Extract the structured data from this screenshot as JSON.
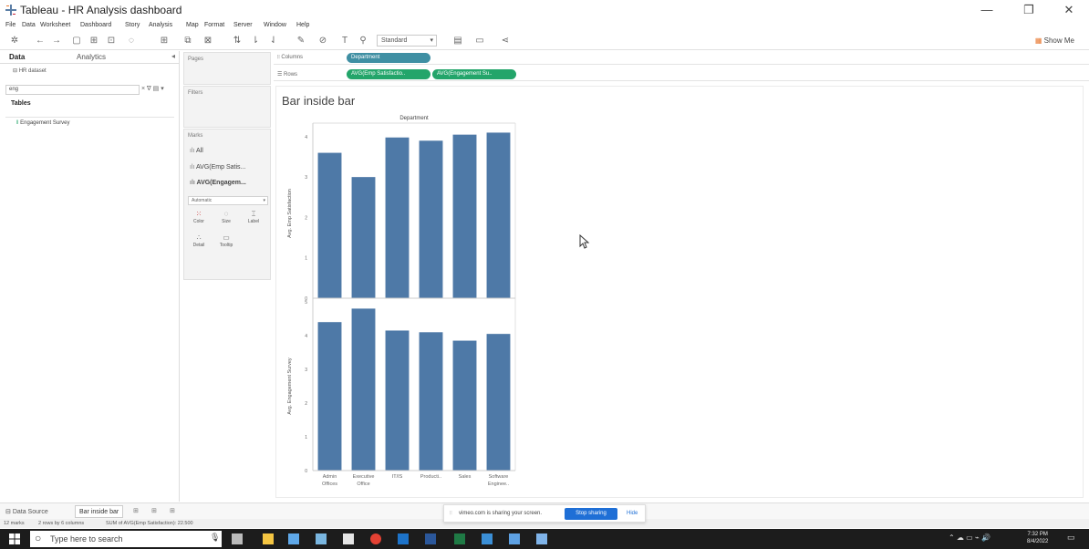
{
  "window": {
    "title": "Tableau - HR Analysis dashboard",
    "controls": [
      "—",
      "❐",
      "✕"
    ]
  },
  "menu": [
    "File",
    "Data",
    "Worksheet",
    "Dashboard",
    "Story",
    "Analysis",
    "Map",
    "Format",
    "Server",
    "Window",
    "Help"
  ],
  "toolbar": {
    "fit_select": "Standard",
    "show_me": "Show Me"
  },
  "data_pane": {
    "tab_data": "Data",
    "tab_analytics": "Analytics",
    "datasource": "HR dataset",
    "search_value": "eng",
    "tables_header": "Tables",
    "field": "Engagement Survey"
  },
  "cards": {
    "pages": "Pages",
    "filters": "Filters",
    "marks": "Marks",
    "marks_rows": [
      "All",
      "AVG(Emp Satis...",
      "AVG(Engagem..."
    ],
    "mark_type": "Automatic",
    "mark_buttons": [
      "Color",
      "Size",
      "Label",
      "Detail",
      "Tooltip"
    ]
  },
  "shelves": {
    "columns_label": "Columns",
    "rows_label": "Rows",
    "columns_pill": "Department",
    "rows_pills": [
      "AVG(Emp Satisfactio..",
      "AVG(Engagement Su.."
    ]
  },
  "colors": {
    "bar": "#4e79a7",
    "pill_dimension": "#3f8fa3",
    "pill_measure": "#23a56a",
    "stop_sharing": "#1f6fd6"
  },
  "viz": {
    "title": "Bar inside bar"
  },
  "chart_data": {
    "type": "bar",
    "title": "Bar inside bar",
    "column_header": "Department",
    "categories": [
      "Admin Offices",
      "Executive Office",
      "IT/IS",
      "Production",
      "Sales",
      "Software Engineering"
    ],
    "category_labels": [
      [
        "Admin",
        "Offices"
      ],
      [
        "Executive",
        "Office"
      ],
      [
        "IT/IS"
      ],
      [
        "Producti.."
      ],
      [
        "Sales"
      ],
      [
        "Software",
        "Enginee.."
      ]
    ],
    "panes": [
      {
        "ylabel": "Avg. Emp Satisfaction",
        "ylim": [
          0,
          4.2
        ],
        "ticks": [
          0,
          1,
          2,
          3,
          4
        ],
        "values": [
          3.6,
          3.0,
          3.98,
          3.9,
          4.05,
          4.1
        ]
      },
      {
        "ylabel": "Avg. Engagement Survey",
        "ylim": [
          0,
          5
        ],
        "ticks": [
          0,
          1,
          2,
          3,
          4,
          5
        ],
        "values": [
          4.4,
          4.8,
          4.15,
          4.1,
          3.85,
          4.05
        ]
      }
    ]
  },
  "sheet_tabs": {
    "data_source": "Data Source",
    "active_sheet": "Bar inside bar"
  },
  "status": {
    "marks": "12 marks",
    "rows_cols": "2 rows by 6 columns",
    "sum": "SUM of AVG(Emp Satisfaction): 22.500"
  },
  "notification": {
    "text": "vimeo.com is sharing your screen.",
    "stop": "Stop sharing",
    "hide": "Hide"
  },
  "taskbar": {
    "search_placeholder": "Type here to search",
    "time": "7:32 PM",
    "date": "8/4/2022"
  }
}
